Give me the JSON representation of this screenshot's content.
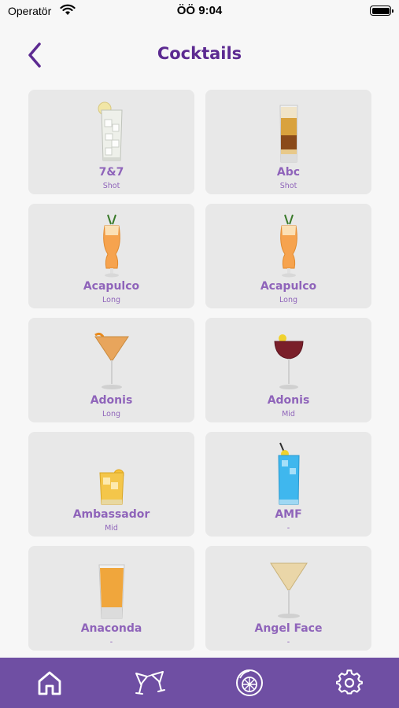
{
  "status_bar": {
    "carrier": "Operatör",
    "time": "ÖÖ 9:04"
  },
  "header": {
    "title": "Cocktails"
  },
  "cocktails": [
    {
      "name": "7&7",
      "type": "Shot",
      "icon": "highball-ice-glass-icon"
    },
    {
      "name": "Abc",
      "type": "Shot",
      "icon": "layered-shot-glass-icon"
    },
    {
      "name": "Acapulco",
      "type": "Long",
      "icon": "hurricane-glass-icon"
    },
    {
      "name": "Acapulco",
      "type": "Long",
      "icon": "hurricane-glass-icon"
    },
    {
      "name": "Adonis",
      "type": "Long",
      "icon": "martini-glass-icon"
    },
    {
      "name": "Adonis",
      "type": "Mid",
      "icon": "coupe-glass-icon"
    },
    {
      "name": "Ambassador",
      "type": "Mid",
      "icon": "rocks-glass-icon"
    },
    {
      "name": "AMF",
      "type": "-",
      "icon": "blue-highball-glass-icon"
    },
    {
      "name": "Anaconda",
      "type": "-",
      "icon": "shot-glass-icon"
    },
    {
      "name": "Angel Face",
      "type": "-",
      "icon": "martini-glass-icon"
    }
  ],
  "bottom_nav": [
    {
      "icon": "home-icon",
      "active": true
    },
    {
      "icon": "cocktail-glasses-icon",
      "active": false
    },
    {
      "icon": "citrus-icon",
      "active": false
    },
    {
      "icon": "gear-icon",
      "active": false
    }
  ],
  "colors": {
    "accent": "#5c2a91",
    "label": "#8f64ba",
    "nav_bg": "#6f4fa3",
    "card_bg": "#e8e8e8"
  }
}
